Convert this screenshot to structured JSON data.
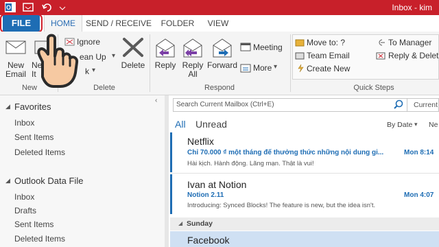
{
  "window": {
    "title": "Inbox - kim"
  },
  "tabs": [
    "FILE",
    "HOME",
    "SEND / RECEIVE",
    "FOLDER",
    "VIEW"
  ],
  "ribbon": {
    "new_group": {
      "new_email": "New\nEmail",
      "new_items_partial": "Ne\nIt",
      "label": "New"
    },
    "delete_group": {
      "ignore": "Ignore",
      "clean_up": "ean Up",
      "junk": "k",
      "delete": "Delete",
      "label": "Delete"
    },
    "respond_group": {
      "reply": "Reply",
      "reply_all": "Reply\nAll",
      "forward": "Forward",
      "meeting": "Meeting",
      "more": "More",
      "label": "Respond"
    },
    "quick_steps": {
      "move_to": "Move to: ?",
      "team_email": "Team Email",
      "create_new": "Create New",
      "to_manager": "To Manager",
      "reply_delete": "Reply & Delet",
      "label": "Quick Steps"
    }
  },
  "folders": {
    "favorites_header": "Favorites",
    "favorites": [
      "Inbox",
      "Sent Items",
      "Deleted Items"
    ],
    "data_file_header": "Outlook Data File",
    "data_file": [
      "Inbox",
      "Drafts",
      "Sent Items",
      "Deleted Items"
    ]
  },
  "search": {
    "placeholder": "Search Current Mailbox (Ctrl+E)",
    "scope": "Current"
  },
  "filters": {
    "all": "All",
    "unread": "Unread",
    "sort": "By Date",
    "order": "Ne"
  },
  "messages": [
    {
      "sender": "Netflix",
      "subject": "Chỉ 70.000 ₫ một tháng để thưởng thức những nội dung gi...",
      "date": "Mon 8:14",
      "preview": "Hài kịch. Hành động. Lãng mạn. Thật là vui!"
    },
    {
      "sender": "Ivan at Notion",
      "subject": "Notion 2.11",
      "date": "Mon 4:07",
      "preview": "Introducing: Synced Blocks! The feature is new, but the idea isn't."
    }
  ],
  "group_header": "Sunday",
  "next_sender": "Facebook",
  "colors": {
    "title_bar": "#c8202a",
    "accent": "#1e6db4",
    "highlight_box": "#d21f2a",
    "hand_fill": "#f6c9a2"
  }
}
